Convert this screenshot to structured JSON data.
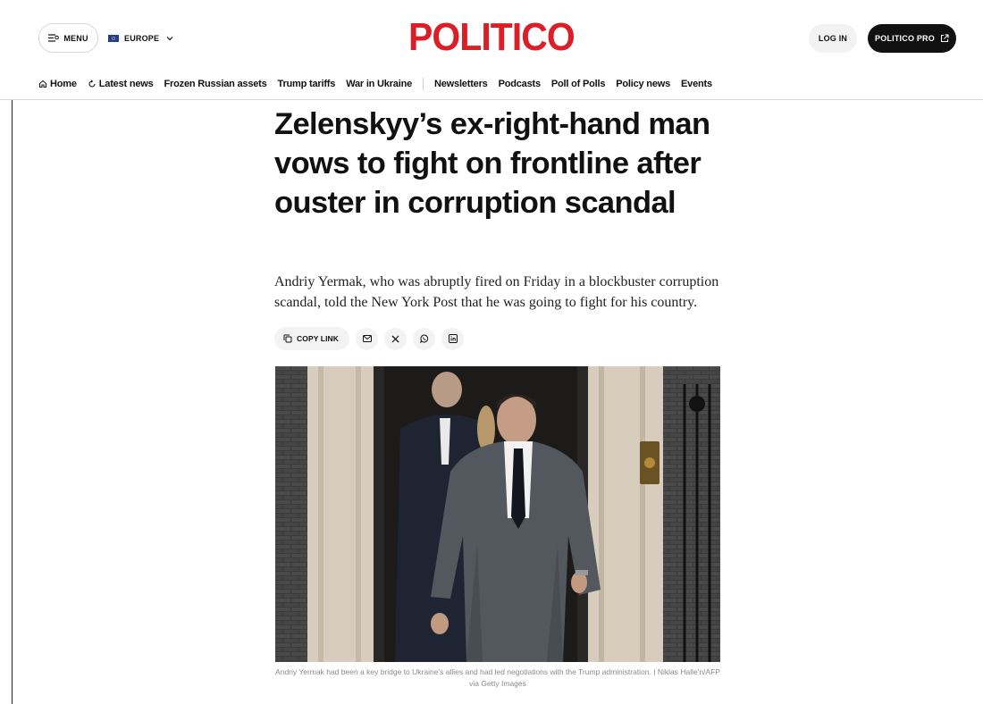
{
  "header": {
    "menu_label": "MENU",
    "region_label": "EUROPE",
    "logo": "POLITICO",
    "login_label": "LOG IN",
    "pro_label": "POLITICO PRO",
    "brand_color": "#dc1f26"
  },
  "nav": {
    "items": [
      {
        "label": "Home",
        "icon": "home-icon"
      },
      {
        "label": "Latest news",
        "icon": "refresh-icon"
      },
      {
        "label": "Frozen Russian assets"
      },
      {
        "label": "Trump tariffs"
      },
      {
        "label": "War in Ukraine"
      },
      {
        "label": "Newsletters"
      },
      {
        "label": "Podcasts"
      },
      {
        "label": "Poll of Polls"
      },
      {
        "label": "Policy news"
      },
      {
        "label": "Events"
      }
    ]
  },
  "article": {
    "headline": "Zelenskyy’s ex-right-hand man vows to fight on frontline after ouster in corruption scandal",
    "dek": "Andriy Yermak, who was abruptly fired on Friday in a blockbuster corruption scandal, told the New York Post that he was going to fight for his country.",
    "share": {
      "copy_label": "COPY LINK",
      "buttons": [
        "email-icon",
        "x-icon",
        "whatsapp-icon",
        "linkedin-icon"
      ]
    },
    "caption": "Andriy Yermak had been a key bridge to Ukraine’s allies and had led negotiations with the Trump administration. | Niklas Halle'n/AFP via Getty Images"
  }
}
